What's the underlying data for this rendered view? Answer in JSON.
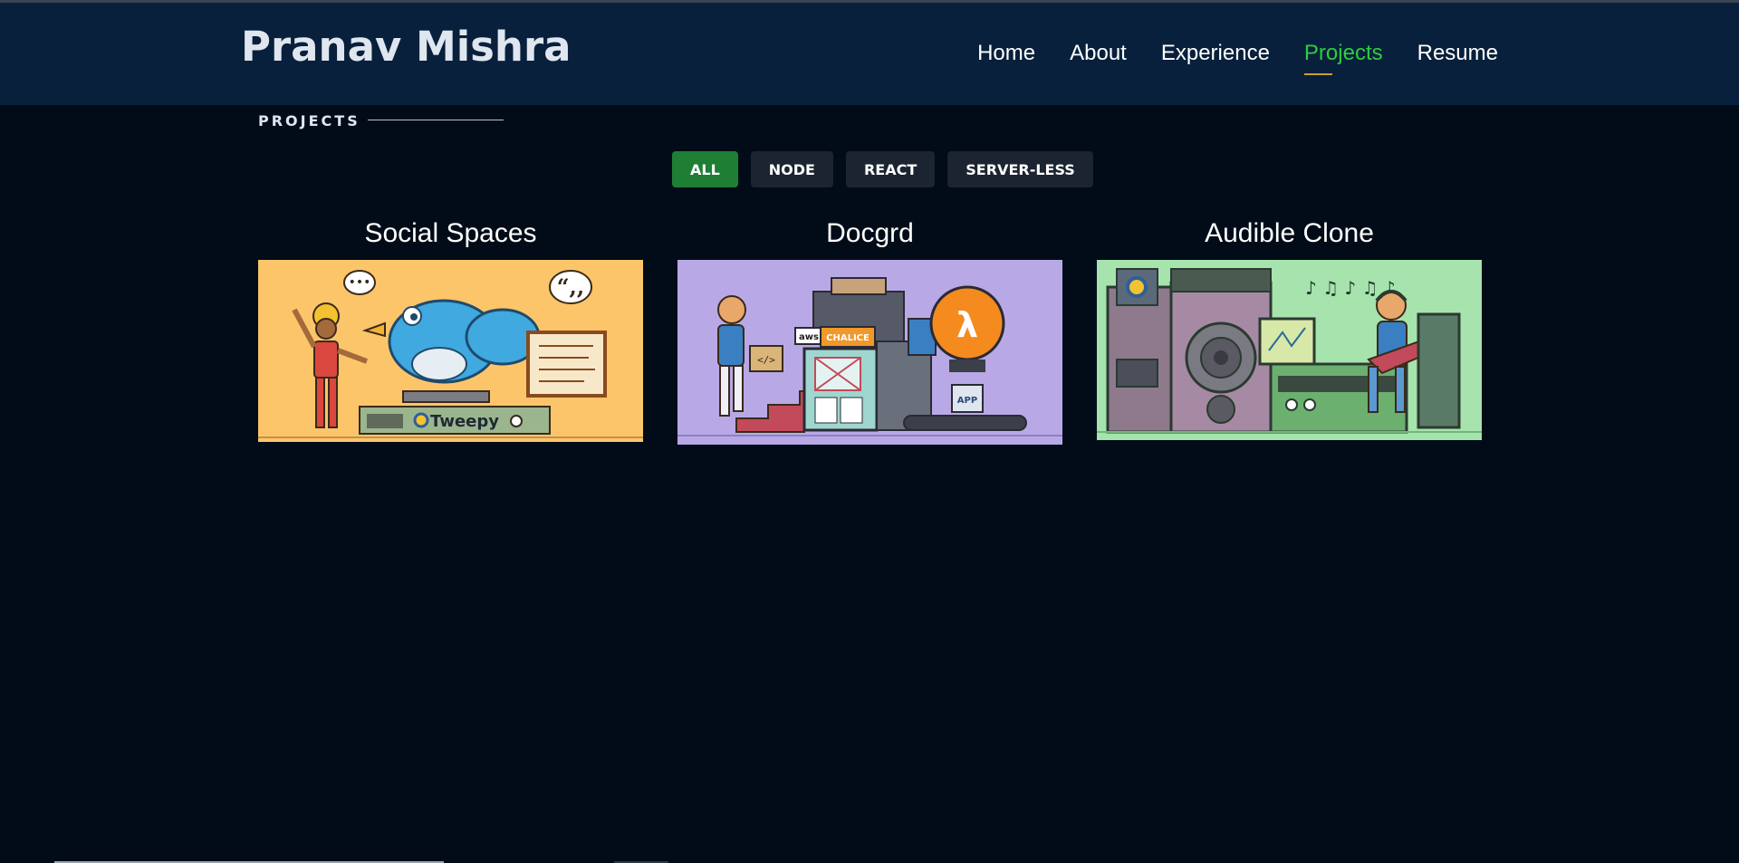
{
  "site": {
    "brand": "Pranav Mishra"
  },
  "nav": {
    "items": [
      {
        "label": "Home",
        "active": false
      },
      {
        "label": "About",
        "active": false
      },
      {
        "label": "Experience",
        "active": false
      },
      {
        "label": "Projects",
        "active": true
      },
      {
        "label": "Resume",
        "active": false
      }
    ]
  },
  "section": {
    "label": "PROJECTS"
  },
  "filters": {
    "items": [
      {
        "label": "ALL",
        "active": true
      },
      {
        "label": "NODE",
        "active": false
      },
      {
        "label": "REACT",
        "active": false
      },
      {
        "label": "SERVER-LESS",
        "active": false
      }
    ]
  },
  "projects": [
    {
      "title": "Social Spaces",
      "image_bg": "#fdc56a",
      "image_text": "Tweepy",
      "image": "twitter-bird-illustration"
    },
    {
      "title": "Docgrd",
      "image_bg": "#b8a9e6",
      "image_text_1": "aws",
      "image_text_2": "CHALICE",
      "image_text_3": "APP",
      "image": "serverless-illustration"
    },
    {
      "title": "Audible Clone",
      "image_bg": "#a6e3ad",
      "image": "music-amplifier-illustration"
    }
  ],
  "colors": {
    "background": "#010c18",
    "header": "#08203b",
    "accent": "#2ecc40",
    "button_active": "#1e7e34",
    "button": "#1b2430"
  }
}
